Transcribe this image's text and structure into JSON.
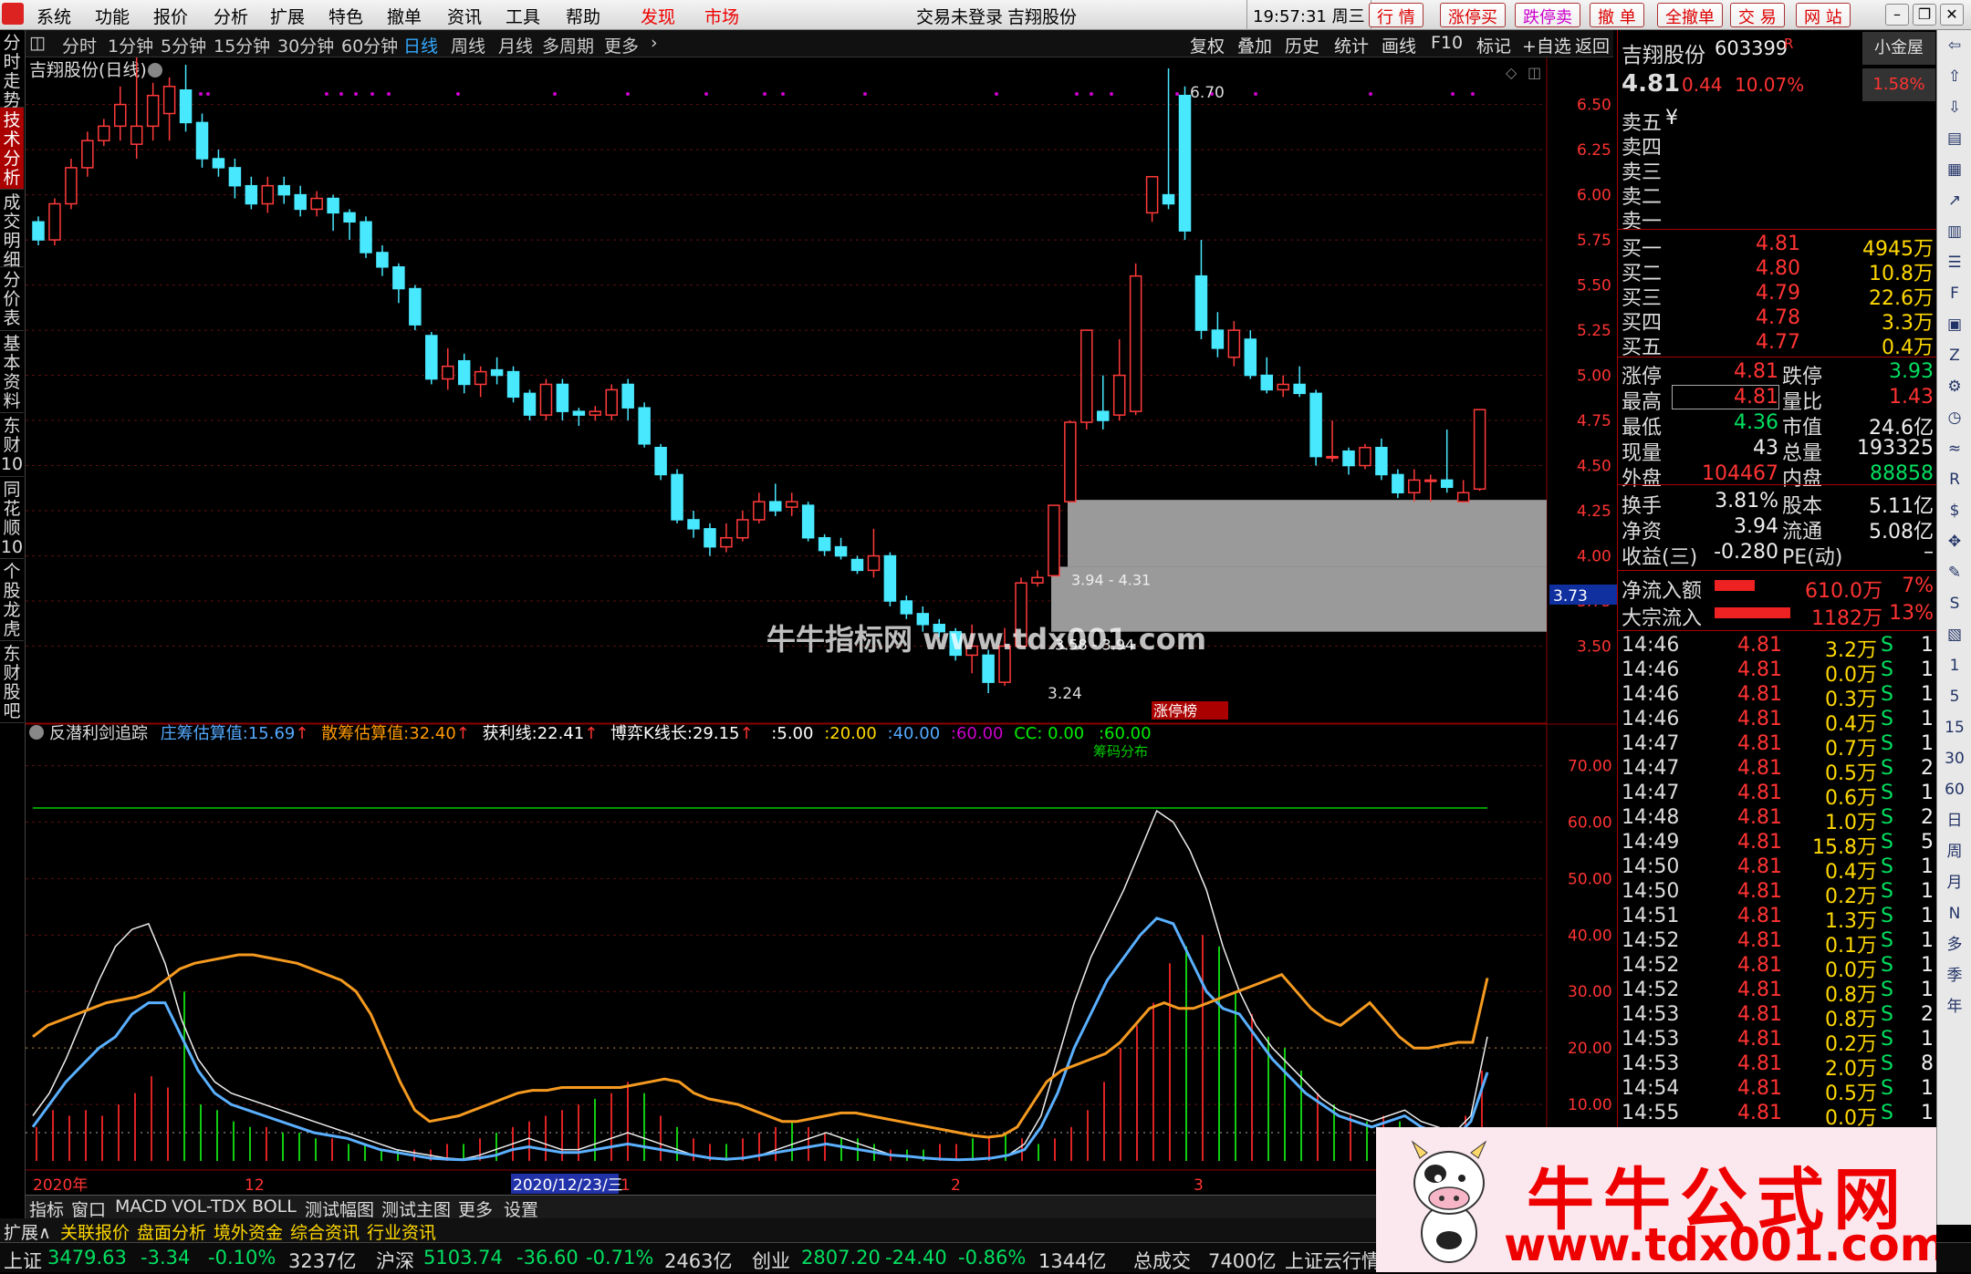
{
  "menubar": {
    "items": [
      "系统",
      "功能",
      "报价",
      "分析",
      "扩展",
      "特色",
      "撤单",
      "资讯",
      "工具",
      "帮助"
    ],
    "discover": "发现",
    "market": "市场",
    "login_status": "交易未登录",
    "stock_name": "吉翔股份",
    "clock": "19:57:31 周三",
    "buttons": [
      "行 情",
      "涨停买",
      "跌停卖",
      "撤 单",
      "全撤单",
      "交 易",
      "网 站"
    ]
  },
  "leftbar": [
    "分时走势",
    "技术分析",
    "成交明细",
    "分价表",
    "基本资料",
    "东财10",
    "同花顺10",
    "个股龙虎",
    "东财股吧"
  ],
  "periodbar": {
    "periods": [
      "分时",
      "1分钟",
      "5分钟",
      "15分钟",
      "30分钟",
      "60分钟",
      "日线",
      "周线",
      "月线",
      "多周期",
      "更多"
    ],
    "tools": [
      "复权",
      "叠加",
      "历史",
      "统计",
      "画线",
      "F10",
      "标记",
      "+自选",
      "返回"
    ]
  },
  "main_chart": {
    "title": "吉翔股份(日线)",
    "price_ticks": [
      "6.50",
      "6.25",
      "6.00",
      "5.75",
      "5.50",
      "5.25",
      "5.00",
      "4.75",
      "4.50",
      "4.25",
      "4.00",
      "3.75",
      "3.50"
    ],
    "high_label": "6.70",
    "low_label": "3.24",
    "current_label": "3.73",
    "zone_label1": "3.94 - 4.31",
    "zone_label2": "3.58 - 3.94",
    "badge": "涨停榜"
  },
  "indicator": {
    "name": "反潜利剑追踪",
    "items": [
      {
        "label": "庄筹估算值",
        "value": "15.69"
      },
      {
        "label": "散筹估算值",
        "value": "32.40"
      },
      {
        "label": "获利线",
        "value": "22.41"
      },
      {
        "label": "博弈K线长",
        "value": "29.15"
      }
    ],
    "levels": [
      "5.00",
      "20.00",
      "40.00",
      "60.00"
    ],
    "cc": "CC: 0.00",
    "sixty": "60.00",
    "ticks": [
      "70.00",
      "60.00",
      "50.00",
      "40.00",
      "30.00",
      "20.00",
      "10.00"
    ],
    "top_note": "筹码分布"
  },
  "xaxis": {
    "labels": [
      "2020年",
      "12",
      "2020/12/23/三",
      "1",
      "2",
      "3"
    ]
  },
  "quote": {
    "name": "吉翔股份",
    "code": "603399",
    "flag": "R",
    "price": "4.81",
    "change": "0.44",
    "pct": "10.07%",
    "btn": "小金屋",
    "small_pct": "1.58%",
    "sell": [
      {
        "l": "卖五",
        "p": "",
        "v": "¥"
      },
      {
        "l": "卖四",
        "p": "",
        "v": ""
      },
      {
        "l": "卖三",
        "p": "",
        "v": ""
      },
      {
        "l": "卖二",
        "p": "",
        "v": ""
      },
      {
        "l": "卖一",
        "p": "",
        "v": ""
      }
    ],
    "buy": [
      {
        "l": "买一",
        "p": "4.81",
        "v": "4945万"
      },
      {
        "l": "买二",
        "p": "4.80",
        "v": "10.8万"
      },
      {
        "l": "买三",
        "p": "4.79",
        "v": "22.6万"
      },
      {
        "l": "买四",
        "p": "4.78",
        "v": "3.3万"
      },
      {
        "l": "买五",
        "p": "4.77",
        "v": "0.4万"
      }
    ],
    "stats": [
      [
        "涨停",
        "4.81",
        "跌停",
        "3.93"
      ],
      [
        "最高",
        "4.81",
        "量比",
        "1.43"
      ],
      [
        "最低",
        "4.36",
        "市值",
        "24.6亿"
      ],
      [
        "现量",
        "43",
        "总量",
        "193325"
      ],
      [
        "外盘",
        "104467",
        "内盘",
        "88858"
      ]
    ],
    "stats2": [
      [
        "换手",
        "3.81%",
        "股本",
        "5.11亿"
      ],
      [
        "净资",
        "3.94",
        "流通",
        "5.08亿"
      ],
      [
        "收益(三)",
        "-0.280",
        "PE(动)",
        "–"
      ]
    ],
    "flows": [
      {
        "l": "净流入额",
        "v": "610.0万",
        "p": "7%",
        "bar": 0.44
      },
      {
        "l": "大宗流入",
        "v": "1182万",
        "p": "13%",
        "bar": 0.83
      }
    ],
    "ticks": [
      [
        "14:46",
        "4.81",
        "3.2万",
        "S",
        "1"
      ],
      [
        "14:46",
        "4.81",
        "0.0万",
        "S",
        "1"
      ],
      [
        "14:46",
        "4.81",
        "0.3万",
        "S",
        "1"
      ],
      [
        "14:46",
        "4.81",
        "0.4万",
        "S",
        "1"
      ],
      [
        "14:47",
        "4.81",
        "0.7万",
        "S",
        "1"
      ],
      [
        "14:47",
        "4.81",
        "0.5万",
        "S",
        "2"
      ],
      [
        "14:47",
        "4.81",
        "0.6万",
        "S",
        "1"
      ],
      [
        "14:48",
        "4.81",
        "1.0万",
        "S",
        "2"
      ],
      [
        "14:49",
        "4.81",
        "15.8万",
        "S",
        "5"
      ],
      [
        "14:50",
        "4.81",
        "0.4万",
        "S",
        "1"
      ],
      [
        "14:50",
        "4.81",
        "0.2万",
        "S",
        "1"
      ],
      [
        "14:51",
        "4.81",
        "1.3万",
        "S",
        "1"
      ],
      [
        "14:52",
        "4.81",
        "0.1万",
        "S",
        "1"
      ],
      [
        "14:52",
        "4.81",
        "0.0万",
        "S",
        "1"
      ],
      [
        "14:52",
        "4.81",
        "0.8万",
        "S",
        "1"
      ],
      [
        "14:53",
        "4.81",
        "0.8万",
        "S",
        "2"
      ],
      [
        "14:53",
        "4.81",
        "0.2万",
        "S",
        "1"
      ],
      [
        "14:53",
        "4.81",
        "2.0万",
        "S",
        "8"
      ],
      [
        "14:54",
        "4.81",
        "0.5万",
        "S",
        "1"
      ],
      [
        "14:55",
        "4.81",
        "0.0万",
        "S",
        "1"
      ]
    ]
  },
  "iconbar": [
    "1",
    "5",
    "15",
    "30",
    "60",
    "日",
    "周",
    "月",
    "N",
    "多",
    "季",
    "年"
  ],
  "tabs1": [
    "指标",
    "窗口",
    "MACD",
    "VOL-TDX",
    "BOLL",
    "测试幅图",
    "测试主图",
    "更多",
    "设置"
  ],
  "tabs2": [
    "扩展∧",
    "关联报价",
    "盘面分析",
    "境外资金",
    "综合资讯",
    "行业资讯"
  ],
  "status": [
    {
      "n": "上证",
      "v": "3479.63",
      "c": "-3.34",
      "p": "-0.10%",
      "a": "3237亿"
    },
    {
      "n": "沪深",
      "v": "5103.74",
      "c": "-36.60",
      "p": "-0.71%",
      "a": "2463亿"
    },
    {
      "n": "创业",
      "v": "2807.20",
      "c": "-24.40",
      "p": "-0.86%",
      "a": "1344亿"
    }
  ],
  "status_total": {
    "l": "总成交",
    "v": "7400亿",
    "t": "上证云行情"
  },
  "brand": {
    "title": "牛牛公式网",
    "url": "www.tdx001.com"
  },
  "watermark": "牛牛指标网 www.tdx001.com",
  "chart_data": {
    "type": "candlestick",
    "price_range": [
      3.2,
      6.75
    ],
    "candles": [
      [
        5.85,
        5.75,
        5.88,
        5.72
      ],
      [
        5.75,
        5.95,
        5.98,
        5.72
      ],
      [
        5.95,
        6.15,
        6.2,
        5.92
      ],
      [
        6.15,
        6.3,
        6.35,
        6.1
      ],
      [
        6.3,
        6.38,
        6.42,
        6.27
      ],
      [
        6.38,
        6.5,
        6.6,
        6.3
      ],
      [
        6.28,
        6.38,
        6.85,
        6.2
      ],
      [
        6.38,
        6.55,
        6.62,
        6.3
      ],
      [
        6.45,
        6.6,
        6.65,
        6.3
      ],
      [
        6.58,
        6.4,
        6.72,
        6.35
      ],
      [
        6.4,
        6.2,
        6.45,
        6.15
      ],
      [
        6.2,
        6.15,
        6.25,
        6.1
      ],
      [
        6.15,
        6.05,
        6.2,
        5.98
      ],
      [
        6.05,
        5.95,
        6.1,
        5.92
      ],
      [
        5.95,
        6.05,
        6.1,
        5.9
      ],
      [
        6.05,
        6.0,
        6.1,
        5.95
      ],
      [
        6.0,
        5.92,
        6.05,
        5.88
      ],
      [
        5.92,
        5.98,
        6.02,
        5.88
      ],
      [
        5.98,
        5.9,
        6.0,
        5.8
      ],
      [
        5.9,
        5.85,
        5.92,
        5.75
      ],
      [
        5.85,
        5.68,
        5.88,
        5.65
      ],
      [
        5.68,
        5.6,
        5.72,
        5.55
      ],
      [
        5.6,
        5.48,
        5.62,
        5.4
      ],
      [
        5.48,
        5.28,
        5.5,
        5.25
      ],
      [
        5.22,
        4.98,
        5.24,
        4.95
      ],
      [
        4.98,
        5.05,
        5.15,
        4.92
      ],
      [
        5.08,
        4.95,
        5.12,
        4.9
      ],
      [
        4.95,
        5.02,
        5.05,
        4.88
      ],
      [
        5.03,
        5.0,
        5.1,
        4.95
      ],
      [
        5.02,
        4.88,
        5.05,
        4.85
      ],
      [
        4.9,
        4.78,
        4.92,
        4.75
      ],
      [
        4.78,
        4.95,
        4.98,
        4.75
      ],
      [
        4.95,
        4.8,
        4.98,
        4.75
      ],
      [
        4.8,
        4.78,
        4.82,
        4.72
      ],
      [
        4.78,
        4.8,
        4.83,
        4.75
      ],
      [
        4.78,
        4.92,
        4.95,
        4.75
      ],
      [
        4.95,
        4.82,
        4.98,
        4.75
      ],
      [
        4.82,
        4.62,
        4.85,
        4.6
      ],
      [
        4.6,
        4.45,
        4.62,
        4.42
      ],
      [
        4.45,
        4.2,
        4.48,
        4.18
      ],
      [
        4.2,
        4.15,
        4.25,
        4.1
      ],
      [
        4.15,
        4.05,
        4.18,
        4.0
      ],
      [
        4.05,
        4.1,
        4.18,
        4.02
      ],
      [
        4.1,
        4.2,
        4.25,
        4.08
      ],
      [
        4.2,
        4.3,
        4.35,
        4.18
      ],
      [
        4.3,
        4.25,
        4.4,
        4.22
      ],
      [
        4.27,
        4.3,
        4.35,
        4.22
      ],
      [
        4.28,
        4.1,
        4.3,
        4.08
      ],
      [
        4.1,
        4.03,
        4.12,
        4.0
      ],
      [
        4.05,
        4.0,
        4.1,
        3.98
      ],
      [
        3.98,
        3.92,
        4.0,
        3.9
      ],
      [
        3.92,
        4.0,
        4.15,
        3.88
      ],
      [
        4.0,
        3.75,
        4.02,
        3.72
      ],
      [
        3.75,
        3.68,
        3.78,
        3.65
      ],
      [
        3.68,
        3.62,
        3.72,
        3.58
      ],
      [
        3.62,
        3.58,
        3.65,
        3.55
      ],
      [
        3.58,
        3.45,
        3.6,
        3.42
      ],
      [
        3.45,
        3.5,
        3.62,
        3.35
      ],
      [
        3.45,
        3.3,
        3.48,
        3.24
      ],
      [
        3.3,
        3.5,
        3.6,
        3.28
      ],
      [
        3.5,
        3.85,
        3.88,
        3.5
      ],
      [
        3.85,
        3.88,
        3.92,
        3.83
      ],
      [
        3.89,
        4.28,
        4.28,
        3.89
      ],
      [
        4.3,
        4.74,
        4.75,
        4.3
      ],
      [
        4.74,
        5.25,
        5.25,
        4.7
      ],
      [
        4.8,
        4.75,
        5.0,
        4.7
      ],
      [
        4.78,
        5.0,
        5.2,
        4.75
      ],
      [
        4.8,
        5.55,
        5.62,
        4.78
      ],
      [
        5.9,
        6.1,
        6.1,
        5.85
      ],
      [
        6.0,
        5.95,
        6.7,
        5.92
      ],
      [
        6.55,
        5.8,
        6.6,
        5.75
      ],
      [
        5.55,
        5.25,
        5.75,
        5.2
      ],
      [
        5.25,
        5.15,
        5.35,
        5.1
      ],
      [
        5.1,
        5.25,
        5.3,
        5.05
      ],
      [
        5.2,
        5.0,
        5.25,
        4.98
      ],
      [
        5.0,
        4.92,
        5.1,
        4.9
      ],
      [
        4.92,
        4.95,
        5.0,
        4.88
      ],
      [
        4.95,
        4.9,
        5.05,
        4.88
      ],
      [
        4.9,
        4.55,
        4.92,
        4.5
      ],
      [
        4.55,
        4.55,
        4.75,
        4.52
      ],
      [
        4.58,
        4.5,
        4.6,
        4.45
      ],
      [
        4.5,
        4.6,
        4.62,
        4.48
      ],
      [
        4.6,
        4.45,
        4.65,
        4.42
      ],
      [
        4.45,
        4.35,
        4.48,
        4.32
      ],
      [
        4.35,
        4.42,
        4.48,
        4.3
      ],
      [
        4.42,
        4.42,
        4.45,
        4.3
      ],
      [
        4.42,
        4.38,
        4.7,
        4.35
      ],
      [
        4.3,
        4.35,
        4.42,
        4.3
      ],
      [
        4.37,
        4.81,
        4.81,
        4.36
      ]
    ]
  }
}
